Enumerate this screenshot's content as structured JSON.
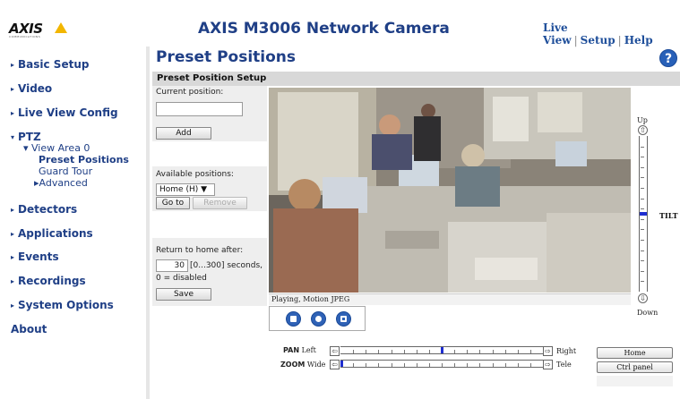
{
  "header": {
    "logo_text": "AXIS",
    "logo_sub": "COMMUNICATIONS",
    "title": "AXIS M3006 Network Camera",
    "links": [
      "Live View",
      "Setup",
      "Help"
    ],
    "link_sep": "|"
  },
  "sidebar": {
    "items": [
      {
        "label": "Basic Setup",
        "arrow": "▸"
      },
      {
        "label": "Video",
        "arrow": "▸"
      },
      {
        "label": "Live View Config",
        "arrow": "▸"
      },
      {
        "label": "PTZ",
        "arrow": "▾"
      },
      {
        "label": "Detectors",
        "arrow": "▸"
      },
      {
        "label": "Applications",
        "arrow": "▸"
      },
      {
        "label": "Events",
        "arrow": "▸"
      },
      {
        "label": "Recordings",
        "arrow": "▸"
      },
      {
        "label": "System Options",
        "arrow": "▸"
      },
      {
        "label": "About",
        "arrow": ""
      }
    ],
    "ptz_sub": {
      "view_area": "▾ View Area 0",
      "preset_positions": "Preset Positions",
      "guard_tour": "Guard Tour",
      "advanced": "▸Advanced"
    }
  },
  "main": {
    "page_title": "Preset Positions",
    "help_symbol": "?",
    "section_title": "Preset Position Setup",
    "current_position_label": "Current position:",
    "current_position_value": "",
    "add_label": "Add",
    "available_label": "Available positions:",
    "available_selected": "Home (H)",
    "goto_label": "Go to",
    "remove_label": "Remove",
    "return_label": "Return to home after:",
    "return_value": "30",
    "return_range": "[0...300] seconds,",
    "return_note": "0 = disabled",
    "save_label": "Save"
  },
  "viewer": {
    "status": "Playing, Motion JPEG",
    "tilt": {
      "up": "Up",
      "down": "Down",
      "label": "TILT",
      "level": 0.5
    },
    "pan": {
      "name": "PAN",
      "left": "Left",
      "right": "Right",
      "level": 0.5
    },
    "zoom": {
      "name": "ZOOM",
      "left": "Wide",
      "right": "Tele",
      "level": 0.0
    },
    "home_label": "Home",
    "ctrl_panel_label": "Ctrl panel"
  },
  "icons": {
    "ctrl": [
      "stop-icon",
      "snapshot-icon",
      "fullscreen-icon"
    ],
    "accent": "#1f3f86",
    "ctrl_blue": "#2f62b6",
    "thumb_blue": "#1f2ed0"
  }
}
